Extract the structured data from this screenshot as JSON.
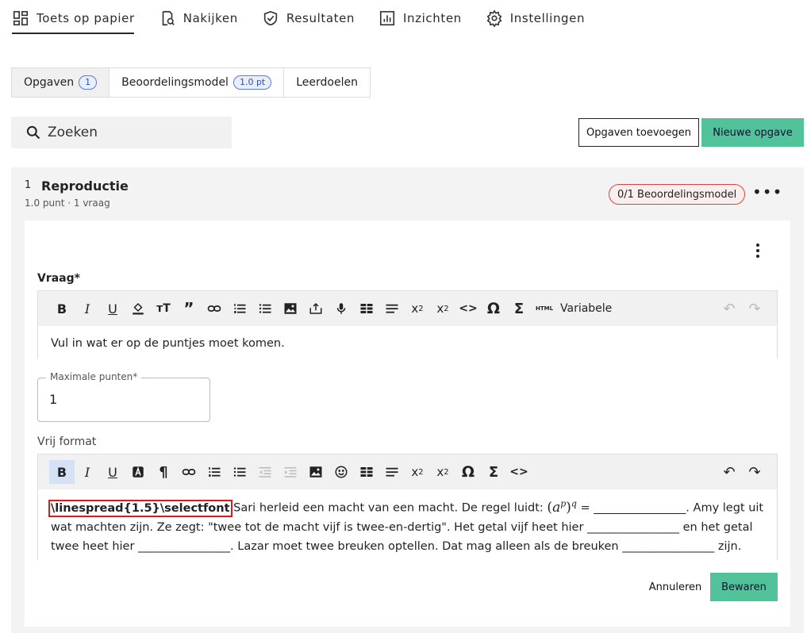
{
  "nav": [
    {
      "label": "Toets op papier",
      "icon": "dashboard-icon"
    },
    {
      "label": "Nakijken",
      "icon": "review-icon"
    },
    {
      "label": "Resultaten",
      "icon": "shield-check-icon"
    },
    {
      "label": "Inzichten",
      "icon": "chart-icon"
    },
    {
      "label": "Instellingen",
      "icon": "gear-icon"
    }
  ],
  "subtabs": {
    "opgaven": "Opgaven",
    "opgaven_count": "1",
    "beoordelingsmodel": "Beoordelingsmodel",
    "beoordelingsmodel_pt": "1.0 pt",
    "leerdoelen": "Leerdoelen"
  },
  "search": {
    "placeholder": "Zoeken"
  },
  "actions": {
    "add": "Opgaven toevoegen",
    "new": "Nieuwe opgave"
  },
  "section": {
    "number": "1",
    "title": "Reproductie",
    "meta": "1.0 punt · 1 vraag",
    "badge": "0/1 Beoordelingsmodel"
  },
  "question": {
    "label": "Vraag*",
    "variable_label": "Variabele",
    "text": "Vul in wat er op de puntjes moet komen."
  },
  "max_points": {
    "label": "Maximale punten*",
    "value": "1"
  },
  "free_format": {
    "label": "Vrij format",
    "highlight": "\\linespread{1.5}\\selectfont",
    "text1": "Sari herleid een macht van een macht. De regel luidt: ",
    "formula_base": "a",
    "formula_p": "p",
    "formula_q": "q",
    "text2": " = ________________. Amy legt uit wat machten zijn. Ze zegt: \"twee tot de macht vijf is twee-en-dertig\". Het getal vijf heet hier ________________ en het getal twee heet hier ________________. Lazar moet twee breuken optellen. Dat mag alleen als de breuken ________________ zijn."
  },
  "buttons": {
    "cancel": "Annuleren",
    "save": "Bewaren"
  },
  "colors": {
    "accent": "#52c29a",
    "badge_red": "#d04545",
    "pill_blue": "#5a7bd6"
  }
}
